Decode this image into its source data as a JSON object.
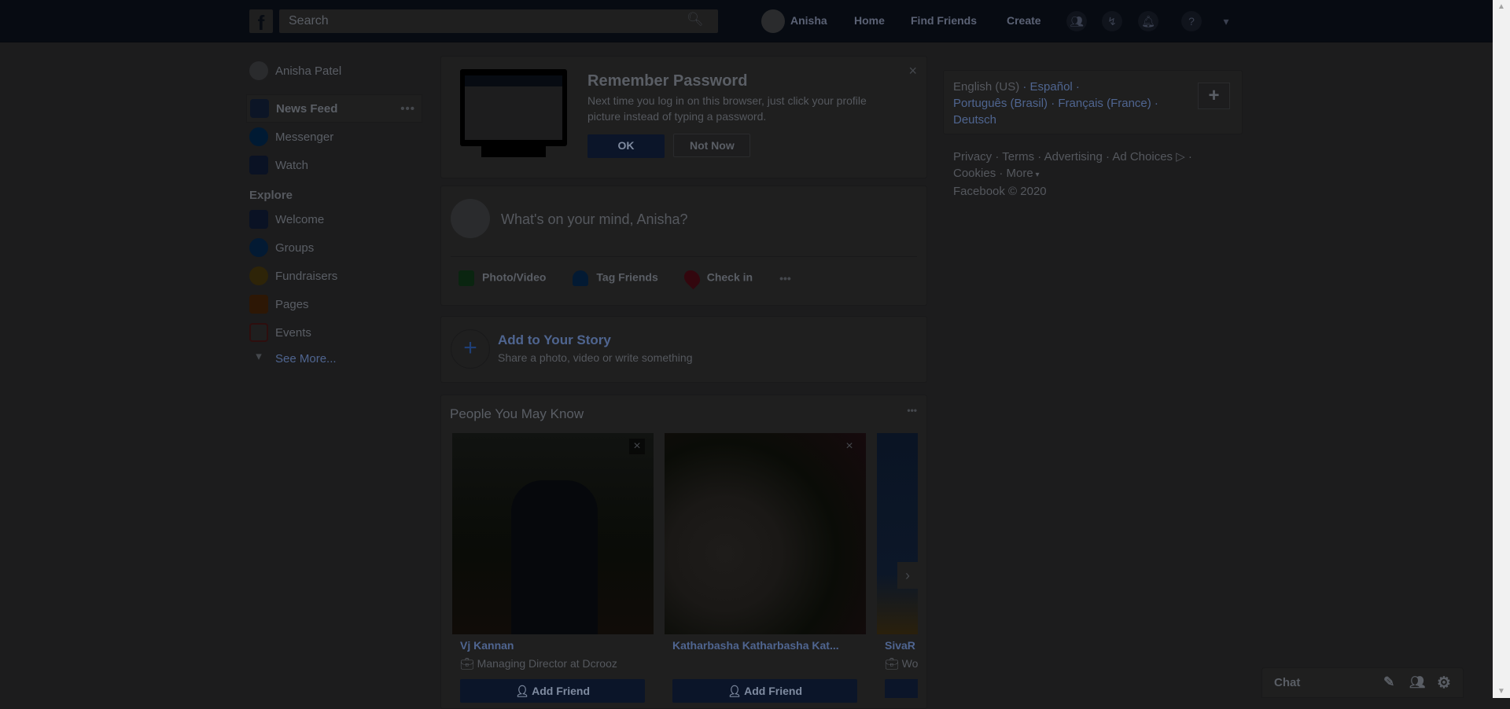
{
  "header": {
    "search_placeholder": "Search",
    "user": "Anisha",
    "nav": [
      "Home",
      "Find Friends",
      "Create"
    ]
  },
  "sidebar": {
    "profile": "Anisha Patel",
    "items": [
      "News Feed",
      "Messenger",
      "Watch"
    ],
    "explore_title": "Explore",
    "explore": [
      "Welcome",
      "Groups",
      "Fundraisers",
      "Pages",
      "Events"
    ],
    "see_more": "See More..."
  },
  "remember": {
    "title": "Remember Password",
    "text": "Next time you log in on this browser, just click your profile picture instead of typing a password.",
    "ok": "OK",
    "not_now": "Not Now"
  },
  "composer": {
    "placeholder": "What's on your mind, Anisha?",
    "actions": [
      "Photo/Video",
      "Tag Friends",
      "Check in"
    ]
  },
  "story": {
    "title": "Add to Your Story",
    "subtitle": "Share a photo, video or write something"
  },
  "pymk": {
    "title": "People You May Know",
    "add": "Add Friend",
    "people": [
      {
        "name": "Vj Kannan",
        "work": "Managing Director at Dcrooz"
      },
      {
        "name": "Katharbasha Katharbasha Kat...",
        "work": ""
      },
      {
        "name": "SivaR",
        "work": "Wo"
      }
    ]
  },
  "languages": [
    "English (US)",
    "Español",
    "Português (Brasil)",
    "Français (France)",
    "Deutsch"
  ],
  "footer": {
    "links": [
      "Privacy",
      "Terms",
      "Advertising",
      "Ad Choices",
      "Cookies",
      "More"
    ],
    "copyright": "Facebook © 2020"
  },
  "chat": {
    "label": "Chat"
  },
  "colors": {
    "brand": "#3b5998",
    "button": "#4267b2",
    "overlay": "rgba(0,0,0,0.88)"
  }
}
